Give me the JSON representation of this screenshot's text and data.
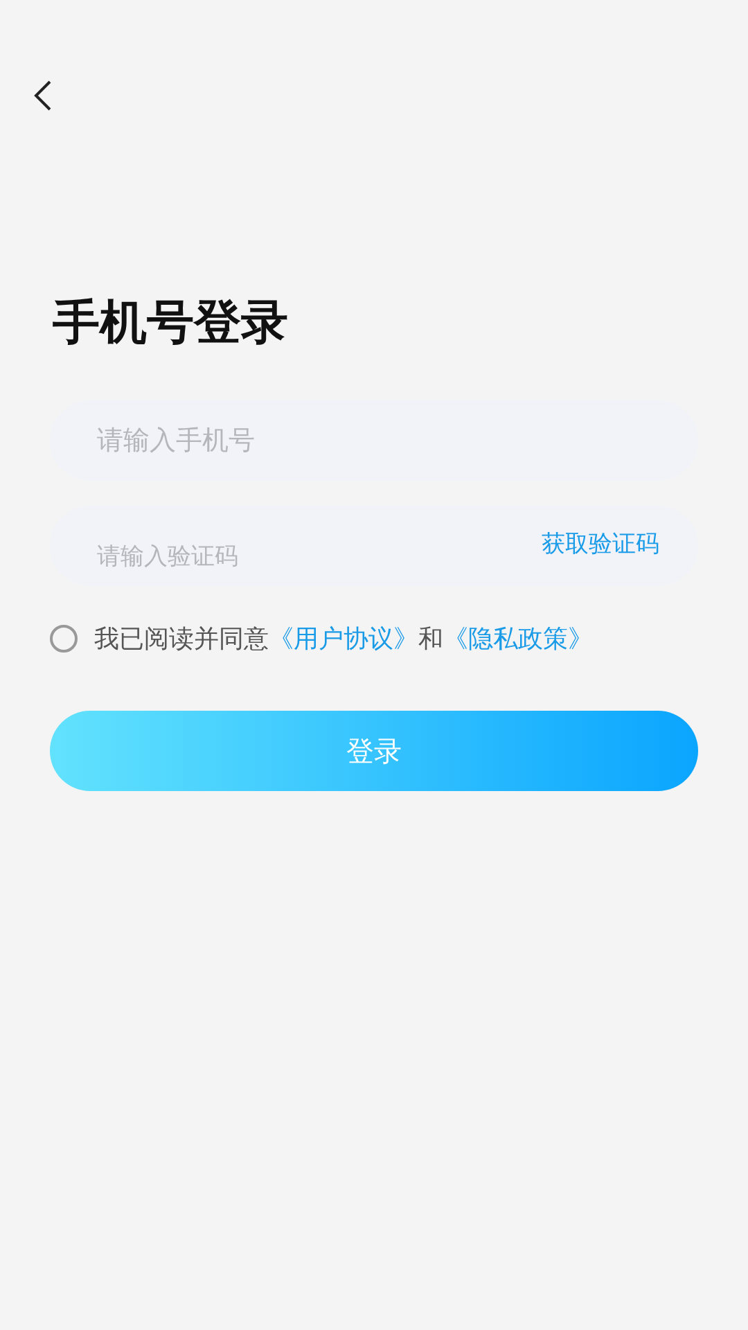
{
  "title": "手机号登录",
  "phone_field": {
    "placeholder": "请输入手机号"
  },
  "code_field": {
    "placeholder": "请输入验证码",
    "action": "获取验证码"
  },
  "agreement": {
    "checked": false,
    "parts": [
      {
        "kind": "text",
        "text": "我已阅读并同意"
      },
      {
        "kind": "link",
        "text": "《用户协议》"
      },
      {
        "kind": "text",
        "text": "和"
      },
      {
        "kind": "link",
        "text": "《隐私政策》"
      }
    ]
  },
  "login_button": "登录"
}
